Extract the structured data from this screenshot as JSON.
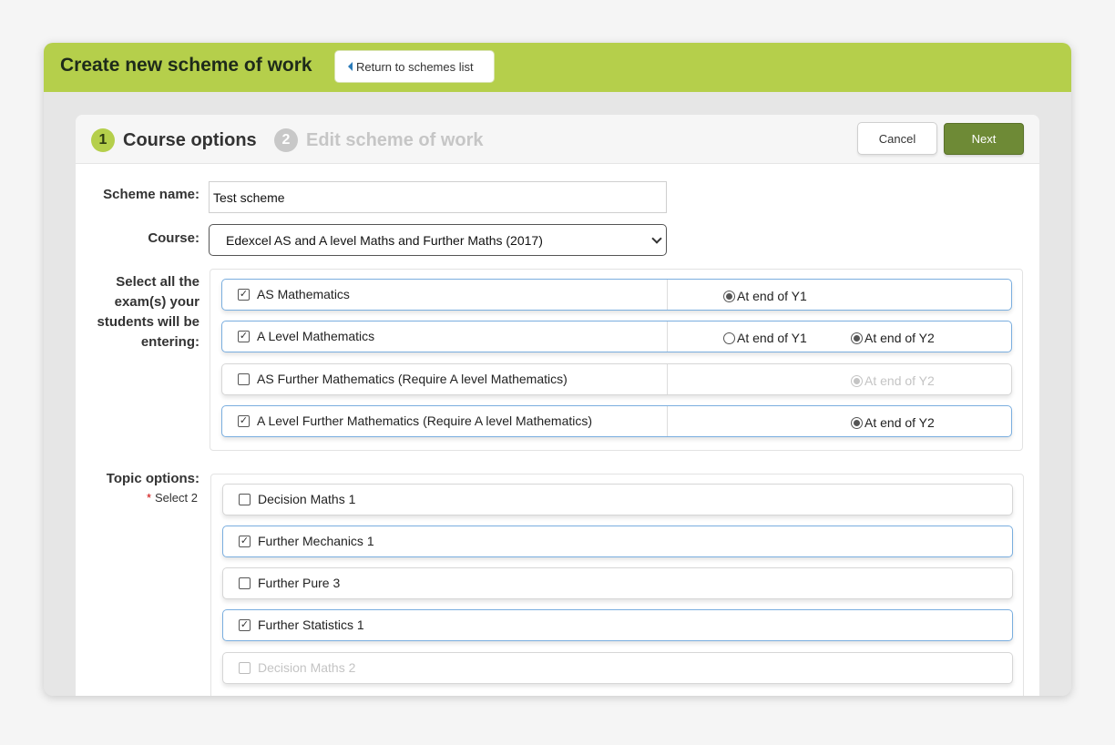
{
  "header": {
    "title": "Create new scheme of work",
    "return_label": "Return to schemes list"
  },
  "steps": [
    {
      "num": "1",
      "label": "Course options"
    },
    {
      "num": "2",
      "label": "Edit scheme of work"
    }
  ],
  "actions": {
    "cancel": "Cancel",
    "next": "Next"
  },
  "form": {
    "scheme_label": "Scheme name:",
    "scheme_value": "Test scheme",
    "course_label": "Course:",
    "course_value": "Edexcel AS and A level Maths and Further Maths (2017)",
    "exams_label": "Select all the exam(s) your students will be entering:",
    "topics_label": "Topic options:",
    "topics_required": "Select 2"
  },
  "exams": [
    {
      "label": "AS Mathematics",
      "checked": true,
      "disabled": false,
      "options": [
        {
          "label": "At end of Y1",
          "selected": true
        }
      ]
    },
    {
      "label": "A Level Mathematics",
      "checked": true,
      "disabled": false,
      "options": [
        {
          "label": "At end of Y1",
          "selected": false
        },
        {
          "label": "At end of Y2",
          "selected": true
        }
      ]
    },
    {
      "label": "AS Further Mathematics (Require A level Mathematics)",
      "checked": false,
      "disabled": false,
      "options": [
        {
          "label": "At end of Y2",
          "selected": true,
          "disabled": true
        }
      ]
    },
    {
      "label": "A Level Further Mathematics (Require A level Mathematics)",
      "checked": true,
      "disabled": false,
      "options": [
        {
          "label": "At end of Y2",
          "selected": true
        }
      ]
    }
  ],
  "topics": [
    {
      "label": "Decision Maths 1",
      "checked": false,
      "disabled": false
    },
    {
      "label": "Further Mechanics 1",
      "checked": true,
      "disabled": false
    },
    {
      "label": "Further Pure 3",
      "checked": false,
      "disabled": false
    },
    {
      "label": "Further Statistics 1",
      "checked": true,
      "disabled": false
    },
    {
      "label": "Decision Maths 2",
      "checked": false,
      "disabled": true
    }
  ],
  "colors": {
    "brand": "#b5cf4b",
    "primary_button": "#6e8a36",
    "selected_border": "#7aaedf"
  }
}
